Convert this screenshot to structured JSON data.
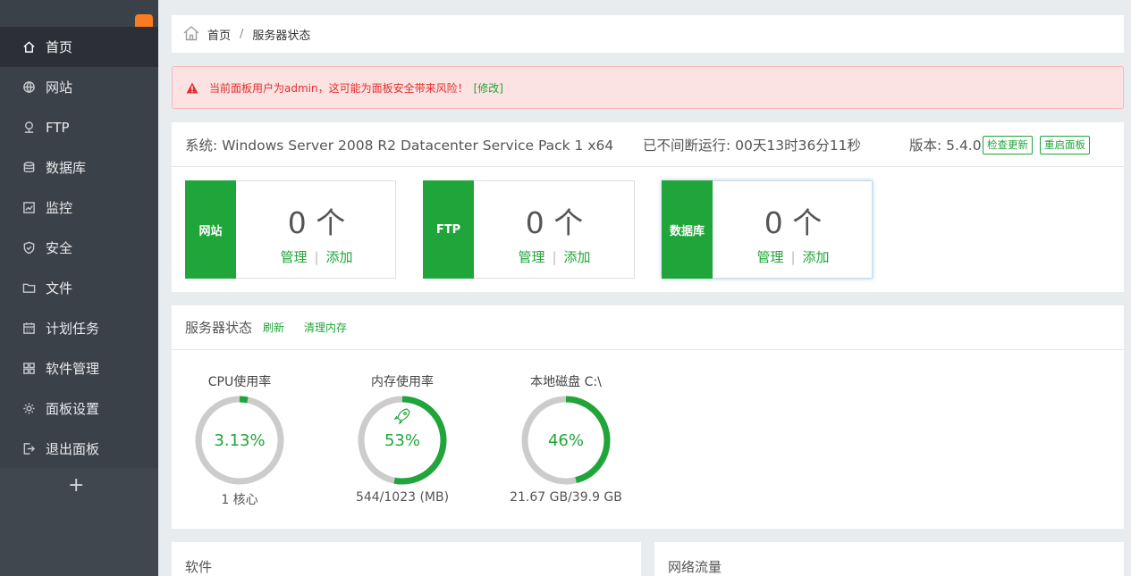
{
  "sidebar": {
    "items": [
      {
        "label": "首页",
        "icon": "home-icon",
        "active": true
      },
      {
        "label": "网站",
        "icon": "globe-icon"
      },
      {
        "label": "FTP",
        "icon": "ftp-icon"
      },
      {
        "label": "数据库",
        "icon": "database-icon"
      },
      {
        "label": "监控",
        "icon": "monitor-icon"
      },
      {
        "label": "安全",
        "icon": "shield-icon"
      },
      {
        "label": "文件",
        "icon": "folder-icon"
      },
      {
        "label": "计划任务",
        "icon": "calendar-icon"
      },
      {
        "label": "软件管理",
        "icon": "grid-icon"
      },
      {
        "label": "面板设置",
        "icon": "gear-icon"
      },
      {
        "label": "退出面板",
        "icon": "logout-icon"
      }
    ],
    "add_label": "+"
  },
  "breadcrumb": {
    "home": "首页",
    "separator": "/",
    "current": "服务器状态"
  },
  "alert": {
    "text": "当前面板用户为admin，这可能为面板安全带来风险！",
    "fix": "[修改]"
  },
  "sysinfo": {
    "system": "系统: Windows Server 2008 R2 Datacenter Service Pack 1 x64",
    "uptime": "已不间断运行: 00天13时36分11秒",
    "version": "版本: 5.4.0",
    "check_update": "检查更新",
    "restart": "重启面板"
  },
  "stats": [
    {
      "label": "网站",
      "count": "0 个",
      "manage": "管理",
      "sep": "|",
      "add": "添加"
    },
    {
      "label": "FTP",
      "count": "0 个",
      "manage": "管理",
      "sep": "|",
      "add": "添加"
    },
    {
      "label": "数据库",
      "count": "0 个",
      "manage": "管理",
      "sep": "|",
      "add": "添加"
    }
  ],
  "server_status": {
    "title": "服务器状态",
    "refresh": "刷新",
    "clear_mem": "清理内存",
    "gauges": [
      {
        "title": "CPU使用率",
        "value": "3.13%",
        "fraction": 0.0313,
        "foot": "1 核心"
      },
      {
        "title": "内存使用率",
        "value": "53%",
        "fraction": 0.53,
        "foot": "544/1023 (MB)",
        "icon": "rocket-icon"
      },
      {
        "title": "本地磁盘 C:\\",
        "value": "46%",
        "fraction": 0.46,
        "foot": "21.67 GB/39.9 GB"
      }
    ]
  },
  "panels": {
    "software": "软件",
    "network": "网络流量"
  },
  "colors": {
    "accent": "#20a53a",
    "sidebar": "#3b4149",
    "alert_bg": "#fde2e2",
    "alert_text": "#e02f2f",
    "badge": "#fa7b21"
  }
}
